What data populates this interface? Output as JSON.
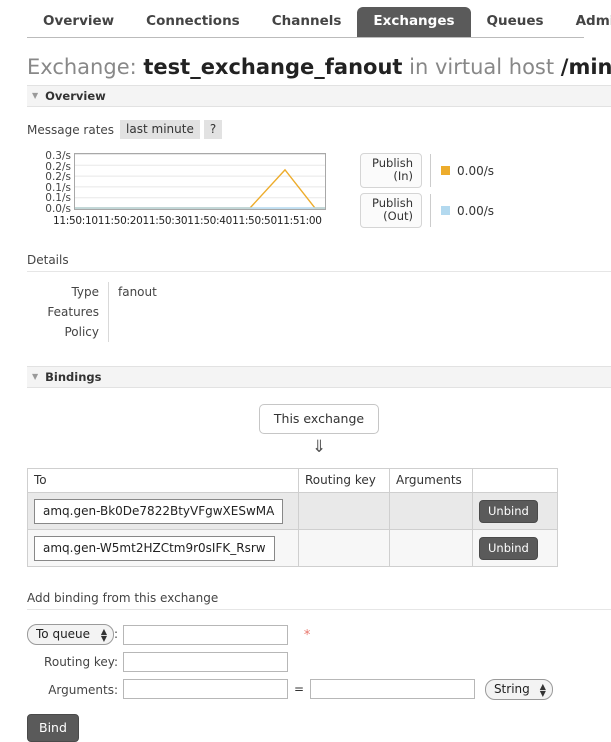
{
  "nav": {
    "tabs": [
      {
        "label": "Overview",
        "active": false
      },
      {
        "label": "Connections",
        "active": false
      },
      {
        "label": "Channels",
        "active": false
      },
      {
        "label": "Exchanges",
        "active": true
      },
      {
        "label": "Queues",
        "active": false
      },
      {
        "label": "Admin",
        "active": false
      }
    ]
  },
  "page": {
    "title_prefix": "Exchange: ",
    "exchange_name": "test_exchange_fanout",
    "title_middle": " in virtual host ",
    "vhost": "/ming"
  },
  "overview": {
    "section_label": "Overview",
    "twisty": "▼",
    "rates_label": "Message rates",
    "period_chip": "last minute",
    "help_chip": "?"
  },
  "chart_data": {
    "type": "line",
    "title": "Message rates",
    "xlabel": "",
    "ylabel": "",
    "ylim": [
      0.0,
      0.3
    ],
    "grid": true,
    "legend_position": "right",
    "y_ticks": [
      "0.3/s",
      "0.2/s",
      "0.2/s",
      "0.1/s",
      "0.1/s",
      "0.0/s"
    ],
    "y_tick_values": [
      0.3,
      0.25,
      0.2,
      0.15,
      0.1,
      0.0
    ],
    "x_ticks": [
      "11:50:10",
      "11:50:20",
      "11:50:30",
      "11:50:40",
      "11:50:50",
      "11:51:00"
    ],
    "series": [
      {
        "name": "Publish (In)",
        "color": "#edac2c",
        "current_value": "0.00/s",
        "x": [
          "11:50:10",
          "11:50:20",
          "11:50:30",
          "11:50:40",
          "11:50:45",
          "11:50:52",
          "11:50:58",
          "11:51:00"
        ],
        "values": [
          0.0,
          0.0,
          0.0,
          0.0,
          0.0,
          0.22,
          0.0,
          0.0
        ]
      },
      {
        "name": "Publish (Out)",
        "color": "#b3d9ef",
        "current_value": "0.00/s",
        "x": [
          "11:50:10",
          "11:50:20",
          "11:50:30",
          "11:50:40",
          "11:50:45",
          "11:50:52",
          "11:50:58",
          "11:51:00"
        ],
        "values": [
          0.0,
          0.0,
          0.0,
          0.0,
          0.0,
          0.0,
          0.0,
          0.0
        ]
      }
    ]
  },
  "details": {
    "title": "Details",
    "rows": [
      {
        "label": "Type",
        "value": "fanout"
      },
      {
        "label": "Features",
        "value": ""
      },
      {
        "label": "Policy",
        "value": ""
      }
    ]
  },
  "bindings": {
    "section_label": "Bindings",
    "twisty": "▼",
    "node_label": "This exchange",
    "arrow": "⇓",
    "columns": [
      "To",
      "Routing key",
      "Arguments",
      ""
    ],
    "rows": [
      {
        "to": "amq.gen-Bk0De7822BtyVFgwXESwMA",
        "routing_key": "",
        "arguments": "",
        "action": "Unbind"
      },
      {
        "to": "amq.gen-W5mt2HZCtm9r0sIFK_Rsrw",
        "routing_key": "",
        "arguments": "",
        "action": "Unbind"
      }
    ]
  },
  "add_binding": {
    "title": "Add binding from this exchange",
    "destination_select": "To queue",
    "destination_value": "",
    "required_marker": "*",
    "routing_key_label": "Routing key:",
    "routing_key_value": "",
    "arguments_label": "Arguments:",
    "argument_key_value": "",
    "equals": "=",
    "argument_val_value": "",
    "argument_type_select": "String",
    "submit_label": "Bind",
    "colon": ":"
  },
  "colors": {
    "active_tab_bg": "#5a5a5a",
    "publish_in": "#edac2c",
    "publish_out": "#b3d9ef",
    "required": "#e8756b"
  }
}
